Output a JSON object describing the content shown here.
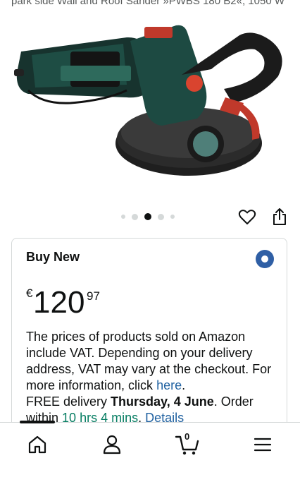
{
  "product": {
    "title_snippet": "park side Wall and Roof Sander »PWBS 180 B2«, 1050 W"
  },
  "carousel": {
    "count": 5,
    "active_index": 2
  },
  "buy_box": {
    "heading": "Buy New",
    "price": {
      "currency": "€",
      "whole": "120",
      "fraction": "97"
    },
    "vat_text": "The prices of products sold on Amazon include VAT. Depending on your delivery address, VAT may vary at the checkout. For more information, click",
    "vat_link": "here",
    "delivery_prefix": "FREE delivery",
    "delivery_date": "Thursday, 4 June",
    "order_within_prefix": ". Order within",
    "order_within_time": "10 hrs 4 mins",
    "details_link": "Details"
  },
  "nav": {
    "home_icon": "home-icon",
    "account_icon": "user-icon",
    "cart_icon": "cart-icon",
    "cart_count": "0",
    "menu_icon": "menu-icon"
  },
  "colors": {
    "link": "#2162a1",
    "green": "#067d62",
    "radio": "#2f5fa5"
  }
}
